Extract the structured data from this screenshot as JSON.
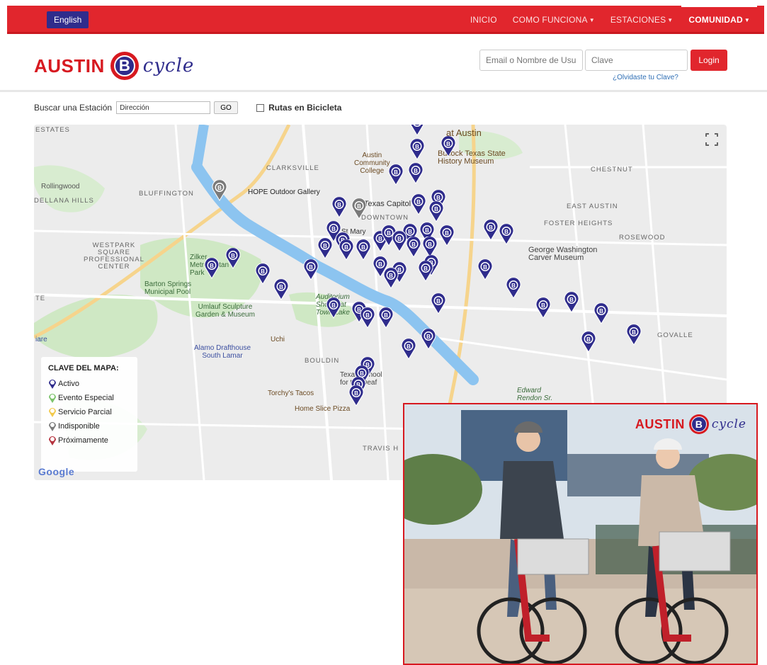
{
  "nav": {
    "language": "English",
    "links": [
      {
        "label": "INICIO",
        "dropdown": false,
        "active": false
      },
      {
        "label": "COMO FUNCIONA",
        "dropdown": true,
        "active": false
      },
      {
        "label": "ESTACIONES",
        "dropdown": true,
        "active": false
      },
      {
        "label": "COMUNIDAD",
        "dropdown": true,
        "active": true
      }
    ]
  },
  "logo": {
    "austin": "AUSTIN",
    "b": "B",
    "cycle": "cycle"
  },
  "login": {
    "user_placeholder": "Email o Nombre de Usu",
    "pass_placeholder": "Clave",
    "button": "Login",
    "forgot": "¿Olvidaste tu Clave?"
  },
  "search": {
    "label": "Buscar una Estación",
    "value": "Dirección",
    "go": "GO",
    "routes_label": "Rutas en Bicicleta"
  },
  "map": {
    "labels": {
      "estates": "ESTATES",
      "clarksville": "CLARKSVILLE",
      "rollingwood": "Rollingwood",
      "bluffington": "BLUFFINGTON",
      "dellana": "DELLANA HILLS",
      "westpark": "WESTPARK\nSQUARE\nPROFESSIONAL\nCENTER",
      "zilker": "Zilker\nMetropolitan\nPark",
      "barton": "Barton Springs\nMunicipal Pool",
      "umlauf": "Umlauf Sculpture\nGarden & Museum",
      "alamo": "Alamo Drafthouse\nSouth Lamar",
      "bouldin": "BOULDIN",
      "torchys": "Torchy's Tacos",
      "homeslice": "Home Slice Pizza",
      "travis": "TRAVIS H",
      "hope": "HOPE Outdoor Gallery",
      "acc": "Austin\nCommunity\nCollege",
      "texascap": "Texas Capitol",
      "downtown": "DOWNTOWN",
      "bullock": "Bullock Texas State\nHistory Museum",
      "utaustin": "at Austin",
      "chestnut": "CHESTNUT",
      "eastaustin": "EAST AUSTIN",
      "foster": "FOSTER HEIGHTS",
      "rosewood": "ROSEWOOD",
      "gwcarver": "George Washington\nCarver Museum",
      "govalle": "GOVALLE",
      "edward": "Edward\nRendon Sr.",
      "uchi": "Uchi",
      "tsd": "Texas School\nfor the Deaf",
      "auditorium": "Auditorium\nShores at\nTown Lake",
      "stmary": "St Mary",
      "te": "TE",
      "iare": "iare"
    },
    "legend": {
      "title": "CLAVE DEL MAPA:",
      "items": [
        {
          "label": "Activo",
          "color": "#2f2c8c"
        },
        {
          "label": "Evento Especial",
          "color": "#7cc36b"
        },
        {
          "label": "Servicio Parcial",
          "color": "#f2c94c"
        },
        {
          "label": "Indisponible",
          "color": "#7a7a7a"
        },
        {
          "label": "Próximamente",
          "color": "#b5333f"
        }
      ]
    },
    "google": "Google",
    "pin_glyph": "B"
  },
  "photo": {
    "austin": "AUSTIN",
    "b": "B",
    "cycle": "cycle"
  }
}
